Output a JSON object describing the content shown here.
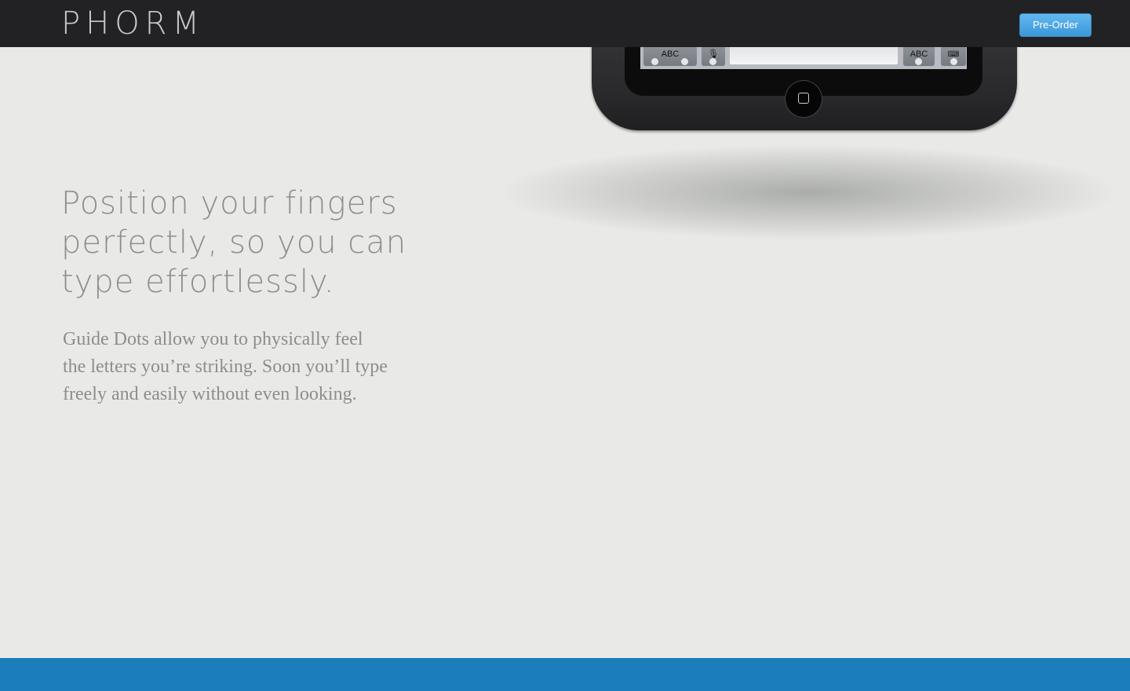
{
  "header": {
    "logo": "PHORM",
    "preorder_label": "Pre-Order"
  },
  "hero": {
    "headline_lines": [
      "Position your fingers",
      "perfectly, so you can",
      "type effortlessly."
    ],
    "body_lines": [
      "Guide Dots allow you to physically feel",
      "the letters you’re striking. Soon you’ll type",
      "freely and easily without even looking."
    ]
  },
  "device": {
    "key_left_label": "ABC",
    "key_right_label": "ABC"
  },
  "colors": {
    "topbar": "#222123",
    "background": "#e9eae8",
    "accent_button": "#4aa6e6",
    "footer_band": "#1c7dbc"
  }
}
